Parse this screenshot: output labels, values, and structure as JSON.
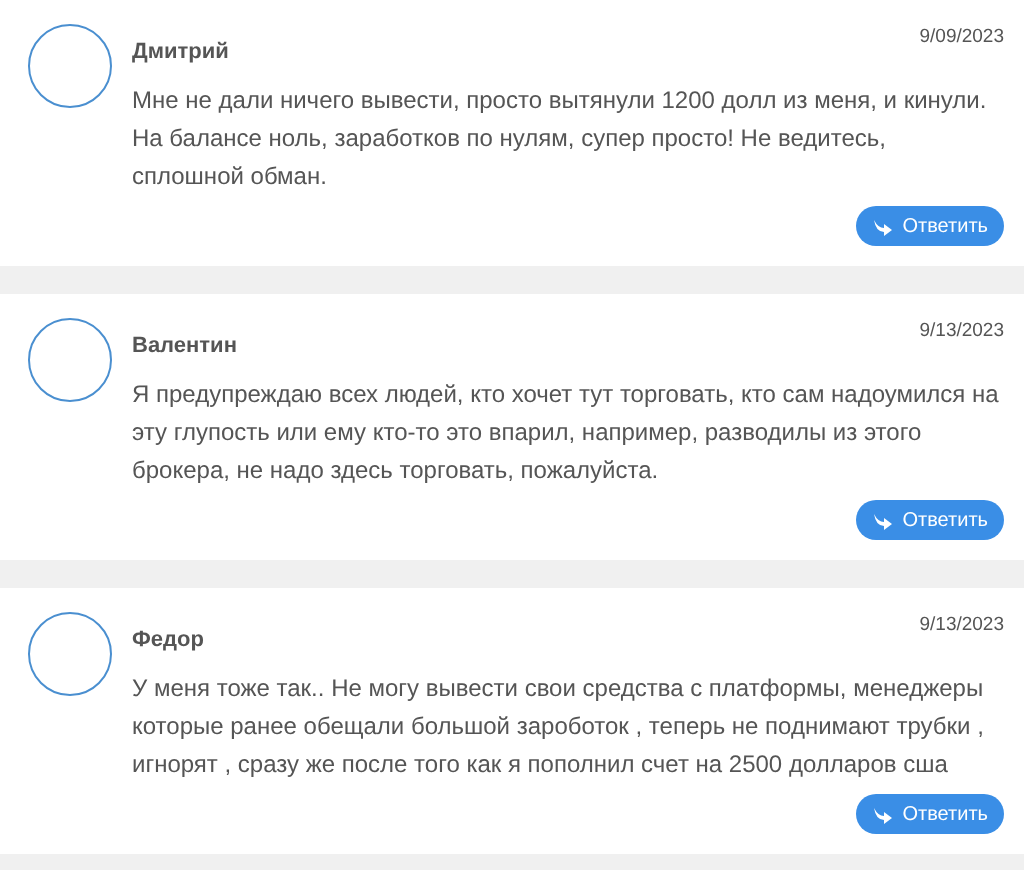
{
  "comments": [
    {
      "author": "Дмитрий",
      "date": "9/09/2023",
      "text": "Мне не дали ничего вывести, просто вытянули 1200 долл из меня, и кинули. На балансе ноль, заработков по нулям, супер просто! Не ведитесь, сплошной обман.",
      "reply": "Ответить"
    },
    {
      "author": "Валентин",
      "date": "9/13/2023",
      "text": "Я предупреждаю всех людей, кто хочет тут торговать, кто сам надоумился на эту глупость или ему кто-то это впарил, например, разводилы из этого брокера, не надо здесь торговать, пожалуйста.",
      "reply": "Ответить"
    },
    {
      "author": "Федор",
      "date": "9/13/2023",
      "text": "У меня тоже так.. Не могу вывести свои средства с платформы, менеджеры которые ранее обещали большой зароботок , теперь не поднимают трубки , игнорят , сразу же после того как я пополнил счет на 2500 долларов сша",
      "reply": "Ответить"
    }
  ]
}
